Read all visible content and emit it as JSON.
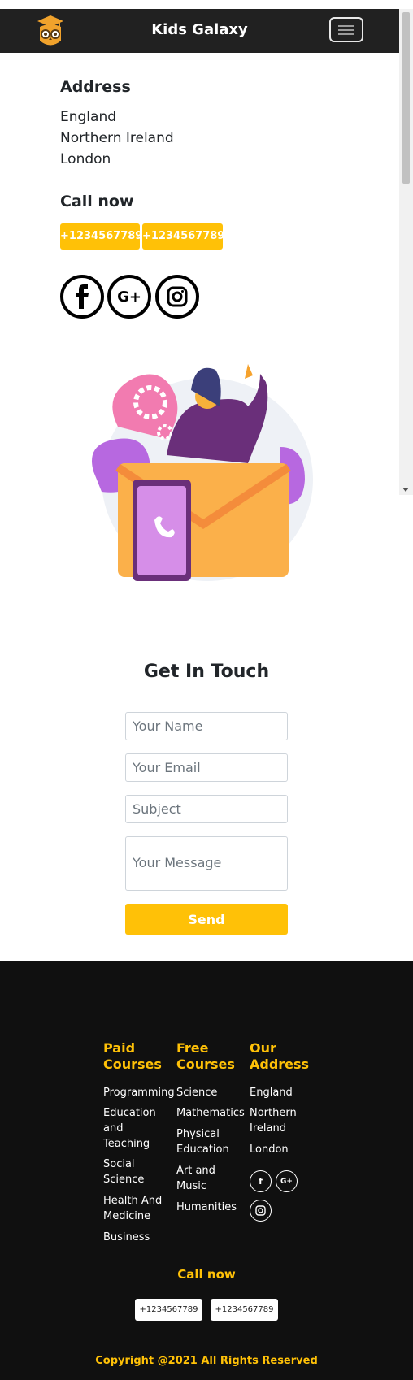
{
  "header": {
    "brand": "Kids Galaxy"
  },
  "contact": {
    "address_title": "Address",
    "address_lines": [
      "England",
      "Northern Ireland",
      "London"
    ],
    "call_title": "Call now",
    "phones": [
      "+1234567789",
      "+1234567789"
    ],
    "social": [
      "facebook-icon",
      "google-plus-icon",
      "instagram-icon"
    ]
  },
  "form": {
    "title": "Get In Touch",
    "name_placeholder": "Your Name",
    "email_placeholder": "Your Email",
    "subject_placeholder": "Subject",
    "message_placeholder": "Your Message",
    "send_label": "Send"
  },
  "footer": {
    "paid": {
      "title": "Paid Courses",
      "items": [
        "Programming",
        "Education and Teaching",
        "Social Science",
        "Health And Medicine",
        "Business"
      ]
    },
    "free": {
      "title": "Free Courses",
      "items": [
        "Science",
        "Mathematics",
        "Physical Education",
        "Art and Music",
        "Humanities"
      ]
    },
    "address": {
      "title": "Our Address",
      "items": [
        "England",
        "Northern Ireland",
        "London"
      ]
    },
    "call_title": "Call now",
    "phones": [
      "+1234567789",
      "+1234567789"
    ],
    "copyright": "Copyright @2021 All Rights Reserved"
  },
  "colors": {
    "accent": "#ffc107",
    "nav": "#212121",
    "footer": "#101010"
  }
}
